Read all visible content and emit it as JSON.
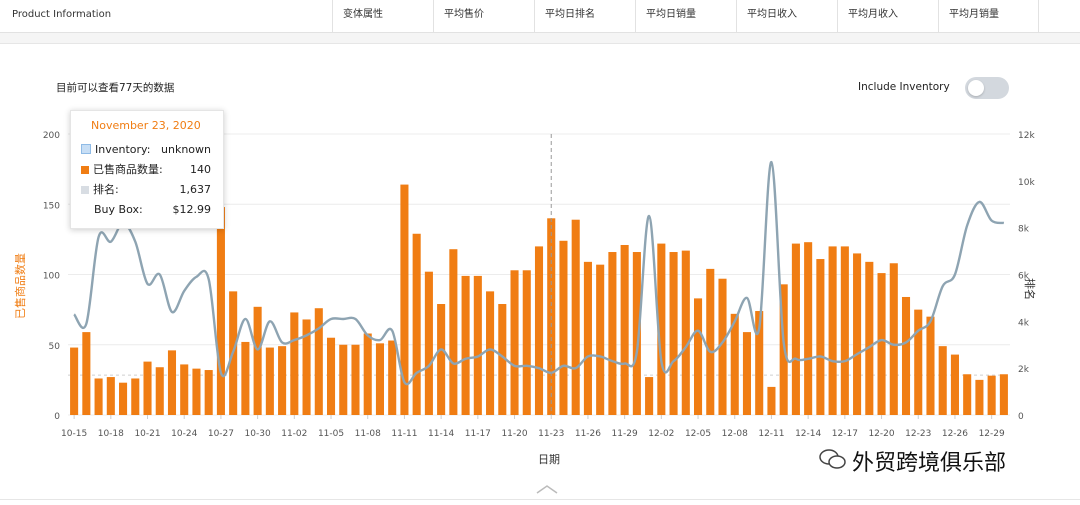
{
  "header": {
    "columns": [
      "Product Information",
      "变体属性",
      "平均售价",
      "平均日排名",
      "平均日销量",
      "平均日收入",
      "平均月收入",
      "平均月销量"
    ]
  },
  "panel": {
    "note": "目前可以查看77天的数据",
    "inventory_label": "Include Inventory",
    "inventory_toggle_on": false
  },
  "tooltip": {
    "date": "November 23, 2020",
    "rows": [
      {
        "label": "Inventory:",
        "value": "unknown",
        "swatch": "#c7def5"
      },
      {
        "label": "已售商品数量:",
        "value": "140",
        "swatch": "#f07d13"
      },
      {
        "label": "排名:",
        "value": "1,637",
        "swatch": "#d8dde3"
      },
      {
        "label": "Buy Box:",
        "value": "$12.99",
        "swatch": ""
      }
    ]
  },
  "watermark": "外贸跨境俱乐部",
  "colors": {
    "bar": "#f07d13",
    "line": "#8ea4b2",
    "accent": "#f07d13"
  },
  "chart_data": {
    "type": "bar",
    "xlabel": "日期",
    "ylabel": "已售商品数量",
    "y2label": "排名",
    "ylim": [
      0,
      200
    ],
    "y2lim": [
      0,
      12000
    ],
    "yticks": [
      0,
      50,
      100,
      150,
      200
    ],
    "y2ticks": [
      "0",
      "2k",
      "4k",
      "6k",
      "8k",
      "10k",
      "12k"
    ],
    "xtick_labels": [
      "10-15",
      "10-18",
      "10-21",
      "10-24",
      "10-27",
      "10-30",
      "11-02",
      "11-05",
      "11-08",
      "11-11",
      "11-14",
      "11-17",
      "11-20",
      "11-23",
      "11-26",
      "11-29",
      "12-02",
      "12-05",
      "12-08",
      "12-11",
      "12-14",
      "12-17",
      "12-20",
      "12-23",
      "12-26",
      "12-29"
    ],
    "dates": [
      "10-15",
      "10-16",
      "10-17",
      "10-18",
      "10-19",
      "10-20",
      "10-21",
      "10-22",
      "10-23",
      "10-24",
      "10-25",
      "10-26",
      "10-27",
      "10-28",
      "10-29",
      "10-30",
      "10-31",
      "11-01",
      "11-02",
      "11-03",
      "11-04",
      "11-05",
      "11-06",
      "11-07",
      "11-08",
      "11-09",
      "11-10",
      "11-11",
      "11-12",
      "11-13",
      "11-14",
      "11-15",
      "11-16",
      "11-17",
      "11-18",
      "11-19",
      "11-20",
      "11-21",
      "11-22",
      "11-23",
      "11-24",
      "11-25",
      "11-26",
      "11-27",
      "11-28",
      "11-29",
      "11-30",
      "12-01",
      "12-02",
      "12-03",
      "12-04",
      "12-05",
      "12-06",
      "12-07",
      "12-08",
      "12-09",
      "12-10",
      "12-11",
      "12-12",
      "12-13",
      "12-14",
      "12-15",
      "12-16",
      "12-17",
      "12-18",
      "12-19",
      "12-20",
      "12-21",
      "12-22",
      "12-23",
      "12-24",
      "12-25",
      "12-26",
      "12-27",
      "12-28",
      "12-29",
      "12-30"
    ],
    "series": [
      {
        "name": "已售商品数量",
        "kind": "bar",
        "values": [
          48,
          59,
          26,
          27,
          23,
          26,
          38,
          34,
          46,
          36,
          33,
          32,
          148,
          88,
          52,
          77,
          48,
          49,
          73,
          68,
          76,
          55,
          50,
          50,
          58,
          51,
          53,
          164,
          129,
          102,
          79,
          118,
          99,
          99,
          88,
          79,
          103,
          103,
          120,
          140,
          124,
          139,
          109,
          107,
          116,
          121,
          116,
          27,
          122,
          116,
          117,
          83,
          104,
          97,
          72,
          59,
          74,
          20,
          93,
          122,
          123,
          111,
          120,
          120,
          115,
          109,
          101,
          108,
          84,
          75,
          70,
          49,
          43,
          29,
          25,
          28,
          29
        ]
      },
      {
        "name": "排名",
        "kind": "line",
        "values": [
          4300,
          3900,
          7600,
          7400,
          8200,
          7400,
          5600,
          6000,
          4400,
          5300,
          5900,
          5800,
          1800,
          2700,
          4100,
          2800,
          4000,
          3100,
          3200,
          3400,
          3700,
          4100,
          4100,
          4100,
          3400,
          3200,
          3600,
          1400,
          1800,
          2100,
          2800,
          2200,
          2400,
          2500,
          2800,
          2500,
          2100,
          2100,
          2000,
          1800,
          2100,
          2000,
          2500,
          2500,
          2300,
          2200,
          2700,
          8500,
          2300,
          2300,
          2900,
          3600,
          2700,
          3100,
          4000,
          5000,
          3700,
          10800,
          3100,
          2400,
          2400,
          2500,
          2300,
          2300,
          2600,
          2900,
          3200,
          3000,
          3100,
          3600,
          4000,
          5500,
          6000,
          8100,
          9100,
          8300,
          8200
        ]
      }
    ],
    "hover_index": 39,
    "grid": true
  }
}
